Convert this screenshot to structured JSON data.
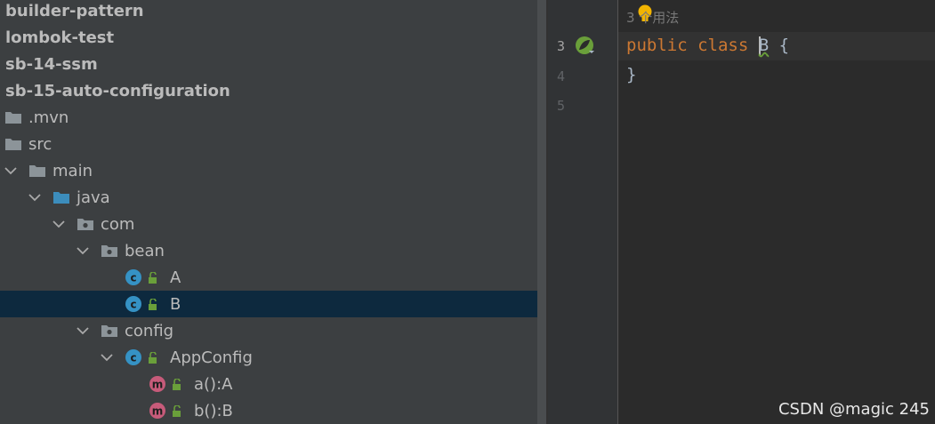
{
  "project_tree": {
    "items": [
      {
        "label": "builder-pattern"
      },
      {
        "label": "lombok-test"
      },
      {
        "label": "sb-14-ssm"
      },
      {
        "label": "sb-15-auto-configuration"
      },
      {
        "label": ".mvn"
      },
      {
        "label": "src"
      },
      {
        "label": "main"
      },
      {
        "label": "java"
      },
      {
        "label": "com"
      },
      {
        "label": "bean"
      },
      {
        "label": "A"
      },
      {
        "label": "B"
      },
      {
        "label": "config"
      },
      {
        "label": "AppConfig"
      },
      {
        "label": "a():A"
      },
      {
        "label": "b():B"
      }
    ],
    "selected": "B"
  },
  "gutter": {
    "line_numbers": [
      "3",
      "4",
      "5"
    ]
  },
  "editor": {
    "usage_hint": "3 个用法",
    "code_line_1": {
      "kw1": "public",
      "kw2": "class",
      "name": "B",
      "brace": "{"
    },
    "code_line_2": "}"
  },
  "watermark": "CSDN @magic 245",
  "colors": {
    "tree_bg": "#3c3f41",
    "selection": "#0d293e",
    "editor_bg": "#2b2b2b",
    "keyword": "#cc7832",
    "class_icon": "#3592c4",
    "method_icon": "#c75b7a",
    "spring_icon": "#6a9f3a"
  }
}
